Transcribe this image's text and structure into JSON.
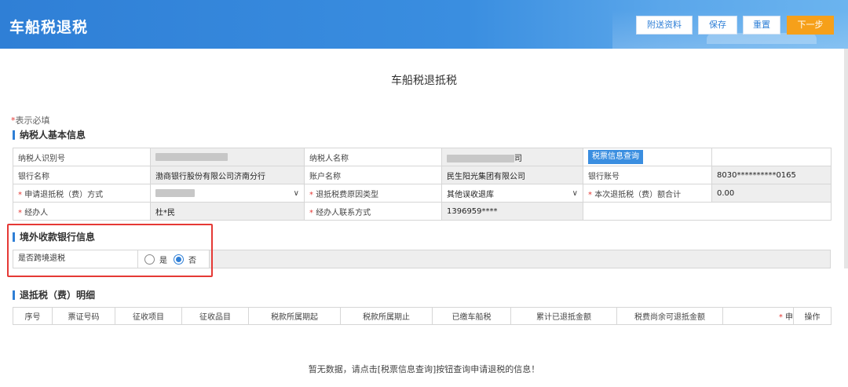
{
  "app": {
    "title": "车船税退税"
  },
  "toolbar": {
    "attach": "附送资料",
    "save": "保存",
    "reset": "重置",
    "next": "下一步"
  },
  "page": {
    "title": "车船税退抵税",
    "required_star": "*",
    "required_note": "表示必填"
  },
  "section_basic": {
    "heading": "纳税人基本信息"
  },
  "basic": {
    "taxpayer_id_label": "纳税人识别号",
    "taxpayer_name_label": "纳税人名称",
    "taxpayer_name_suffix": "司",
    "query_button": "税票信息查询",
    "bank_name_label": "银行名称",
    "bank_name": "渤商银行股份有限公司济南分行",
    "account_name_label": "账户名称",
    "account_name": "民生阳光集团有限公司",
    "bank_account_label": "银行账号",
    "bank_account": "8030**********0165",
    "refund_method_label": "申请退抵税（费）方式",
    "refund_reason_label": "退抵税费原因类型",
    "refund_reason": "其他误收退库",
    "refund_total_label": "本次退抵税（费）额合计",
    "refund_total": "0.00",
    "handler_label": "经办人",
    "handler": "杜*民",
    "handler_phone_label": "经办人联系方式",
    "handler_phone": "1396959****"
  },
  "section_overseas": {
    "heading": "境外收款银行信息"
  },
  "overseas": {
    "cross_border_label": "是否跨境退税",
    "yes": "是",
    "no": "否",
    "selected": "no"
  },
  "section_detail": {
    "heading": "退抵税（费）明细"
  },
  "detail": {
    "columns": [
      "序号",
      "票证号码",
      "征收项目",
      "征收品目",
      "税款所属期起",
      "税款所属期止",
      "已缴车船税",
      "累计已退抵金额",
      "税费尚余可退抵金额",
      "申",
      "操作"
    ],
    "empty_message": "暂无数据，请点击[税票信息查询]按钮查询申请退税的信息！"
  },
  "colors": {
    "brand": "#2f7fd6",
    "next_button": "#f6a01a",
    "required": "#e53935",
    "highlight_box": "#e53935"
  }
}
